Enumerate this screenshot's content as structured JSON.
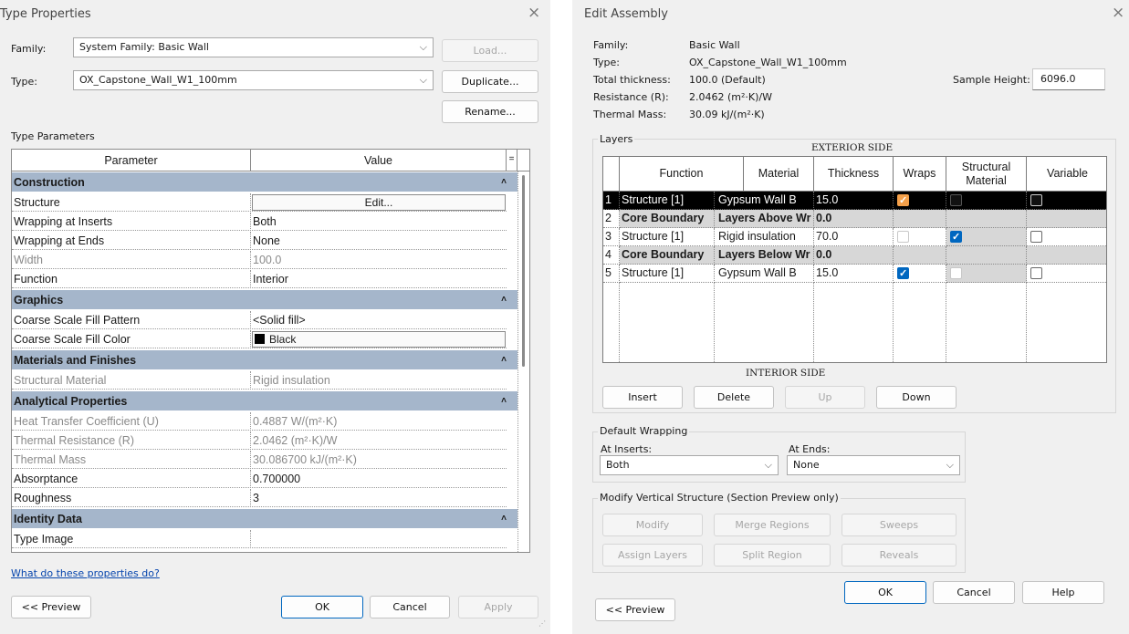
{
  "type_properties": {
    "title": "Type Properties",
    "close_glyph": "×",
    "family_label": "Family:",
    "family_value": "System Family: Basic Wall",
    "type_label": "Type:",
    "type_value": "OX_Capstone_Wall_W1_100mm",
    "load_label": "Load...",
    "duplicate_label": "Duplicate...",
    "rename_label": "Rename...",
    "type_parameters_label": "Type Parameters",
    "col_parameter": "Parameter",
    "col_value": "Value",
    "col_equals": "=",
    "group_collapse_glyph": "˄",
    "groups": {
      "construction": "Construction",
      "graphics": "Graphics",
      "materials": "Materials and Finishes",
      "analytical": "Analytical Properties",
      "identity": "Identity Data"
    },
    "params": {
      "structure": {
        "name": "Structure",
        "value": "Edit..."
      },
      "wrap_inserts": {
        "name": "Wrapping at Inserts",
        "value": "Both"
      },
      "wrap_ends": {
        "name": "Wrapping at Ends",
        "value": "None"
      },
      "width": {
        "name": "Width",
        "value": "100.0"
      },
      "function": {
        "name": "Function",
        "value": "Interior"
      },
      "fill_pattern": {
        "name": "Coarse Scale Fill Pattern",
        "value": "<Solid fill>"
      },
      "fill_color": {
        "name": "Coarse Scale Fill Color",
        "value": "Black",
        "swatch": "#000000"
      },
      "struct_material": {
        "name": "Structural Material",
        "value": "Rigid insulation"
      },
      "heat_coeff": {
        "name": "Heat Transfer Coefficient (U)",
        "value": "0.4887 W/(m²·K)"
      },
      "thermal_res": {
        "name": "Thermal Resistance (R)",
        "value": "2.0462 (m²·K)/W"
      },
      "thermal_mass": {
        "name": "Thermal Mass",
        "value": "30.086700 kJ/(m²·K)"
      },
      "absorptance": {
        "name": "Absorptance",
        "value": "0.700000"
      },
      "roughness": {
        "name": "Roughness",
        "value": "3"
      },
      "type_image": {
        "name": "Type Image",
        "value": ""
      }
    },
    "help_link": "What do these properties do?",
    "preview_label": "<< Preview",
    "ok_label": "OK",
    "cancel_label": "Cancel",
    "apply_label": "Apply",
    "group_color": "#a5b6cb"
  },
  "edit_assembly": {
    "title": "Edit Assembly",
    "close_glyph": "×",
    "info": {
      "family_label": "Family:",
      "family_value": "Basic Wall",
      "type_label": "Type:",
      "type_value": "OX_Capstone_Wall_W1_100mm",
      "thickness_label": "Total thickness:",
      "thickness_value": "100.0 (Default)",
      "resistance_label": "Resistance (R):",
      "resistance_value": "2.0462 (m²·K)/W",
      "mass_label": "Thermal Mass:",
      "mass_value": "30.09 kJ/(m²·K)",
      "sample_label": "Sample Height:",
      "sample_value": "6096.0"
    },
    "layers_legend": "Layers",
    "exterior_side": "EXTERIOR SIDE",
    "interior_side": "INTERIOR SIDE",
    "columns": {
      "function": "Function",
      "material": "Material",
      "thickness": "Thickness",
      "wraps": "Wraps",
      "structural": "Structural Material",
      "variable": "Variable"
    },
    "layers": [
      {
        "num": "1",
        "function": "Structure [1]",
        "material": "Gypsum Wall B",
        "thickness": "15.0"
      },
      {
        "num": "2",
        "function": "Core Boundary",
        "material": "Layers Above Wr",
        "thickness": "0.0"
      },
      {
        "num": "3",
        "function": "Structure [1]",
        "material": "Rigid insulation",
        "thickness": "70.0"
      },
      {
        "num": "4",
        "function": "Core Boundary",
        "material": "Layers Below Wr",
        "thickness": "0.0"
      },
      {
        "num": "5",
        "function": "Structure [1]",
        "material": "Gypsum Wall B",
        "thickness": "15.0"
      }
    ],
    "insert_label": "Insert",
    "delete_label": "Delete",
    "up_label": "Up",
    "down_label": "Down",
    "default_wrapping_legend": "Default Wrapping",
    "at_inserts_label": "At Inserts:",
    "at_inserts_value": "Both",
    "at_ends_label": "At Ends:",
    "at_ends_value": "None",
    "modify_vertical_legend": "Modify Vertical Structure (Section Preview only)",
    "modify_label": "Modify",
    "merge_label": "Merge Regions",
    "sweeps_label": "Sweeps",
    "assign_label": "Assign Layers",
    "split_label": "Split Region",
    "reveals_label": "Reveals",
    "ok_label": "OK",
    "cancel_label": "Cancel",
    "help_label": "Help",
    "preview_label": "<< Preview",
    "checkbox_color": "#0067c0",
    "selected_checkbox_color": "#f4a04a"
  },
  "chevron": "⌵",
  "check": "✓"
}
